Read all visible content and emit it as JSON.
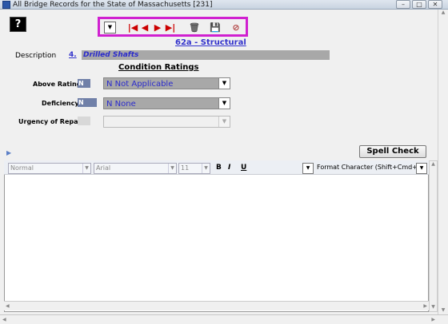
{
  "window": {
    "title": "All Bridge Records for the State of Massachusetts [231]",
    "min_label": "–",
    "max_label": "□",
    "close_label": "✕"
  },
  "help_label": "?",
  "toolbar": {
    "nav_dropdown": "▼",
    "first": "|◀",
    "prev": "◀",
    "next": "▶",
    "last": "▶|",
    "delete": "🗑",
    "save": "💾",
    "cancel": "⊘"
  },
  "section_link": "62a -  Structural",
  "description": {
    "label": "Description",
    "number": "4.",
    "value": "Drilled Shafts"
  },
  "condition_heading": "Condition Ratings",
  "ratings": [
    {
      "label": "Above Rating",
      "code": "N",
      "value": "N Not Applicable",
      "enabled": true
    },
    {
      "label": "Deficiency",
      "code": "N",
      "value": "N    None",
      "enabled": true
    },
    {
      "label": "Urgency of Repair",
      "code": "",
      "value": "",
      "enabled": false
    }
  ],
  "spell_check_label": "Spell Check",
  "editor": {
    "style": "Normal",
    "font": "Arial",
    "size": "11",
    "bold": "B",
    "italic": "I",
    "underline": "U",
    "format_character": "Format Character (Shift+Cmd+F)",
    "content": ""
  }
}
